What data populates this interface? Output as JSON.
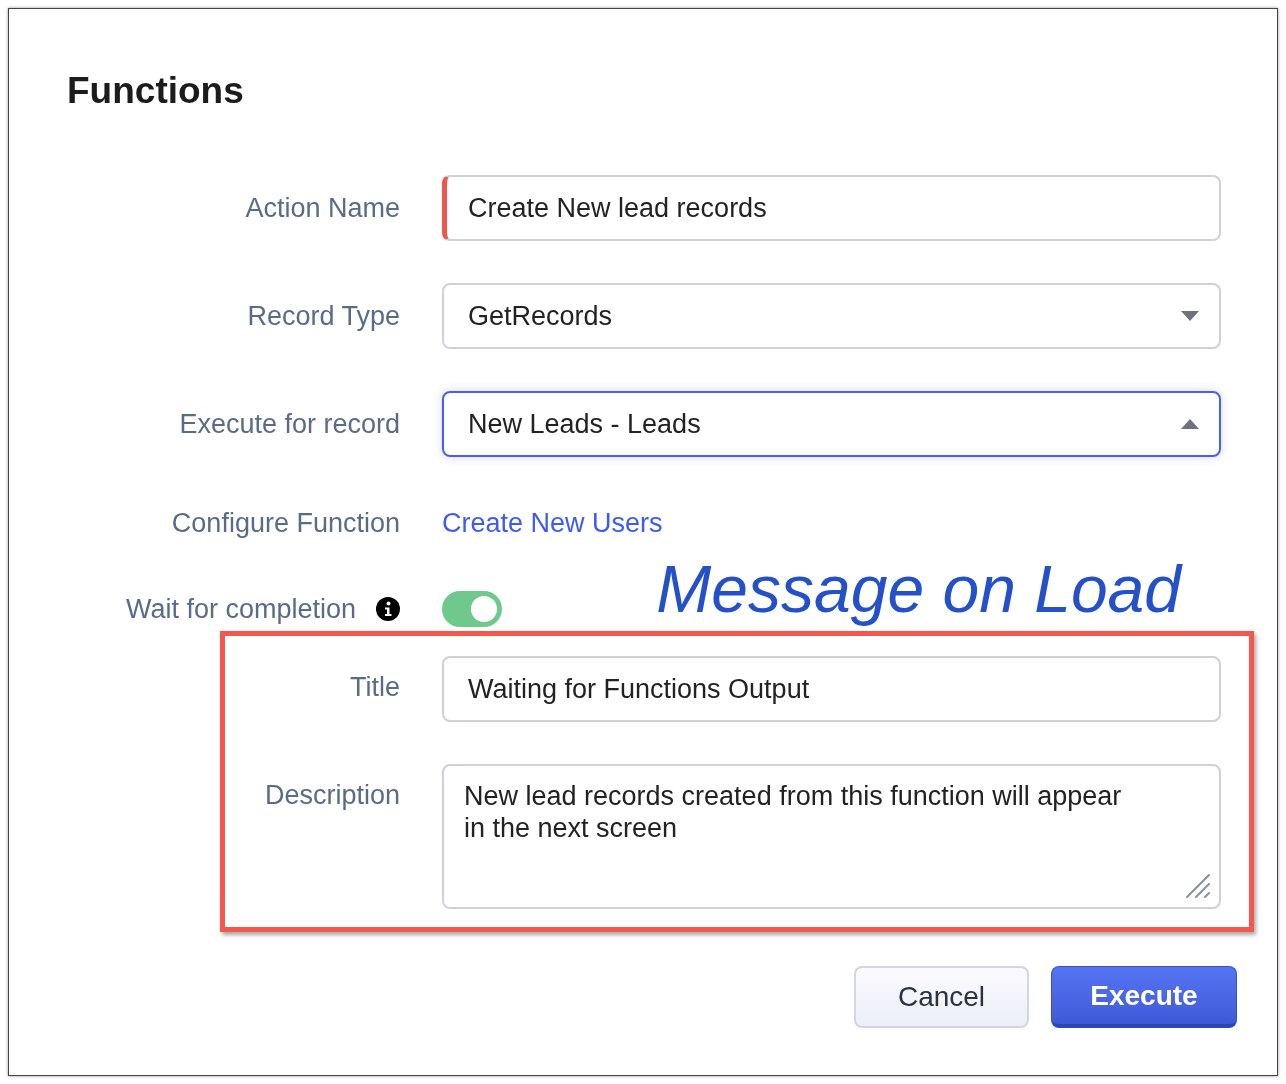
{
  "dialog": {
    "title": "Functions"
  },
  "fields": [
    {
      "kind": "text",
      "label": "Action Name",
      "value": "Create New lead records",
      "required": true
    },
    {
      "kind": "select",
      "label": "Record Type",
      "value": "GetRecords",
      "expanded": false
    },
    {
      "kind": "select",
      "label": "Execute for record",
      "value": "New Leads - Leads",
      "expanded": true
    },
    {
      "kind": "link",
      "label": "Configure Function",
      "value": "Create New Users"
    },
    {
      "kind": "toggle",
      "label": "Wait for completion",
      "on": true
    }
  ],
  "annotation": {
    "text": "Message on Load"
  },
  "message_fields": [
    {
      "kind": "text",
      "label": "Title",
      "value": "Waiting for Functions Output"
    },
    {
      "kind": "textarea",
      "label": "Description",
      "value": "New lead records created from this function will appear in the next screen"
    }
  ],
  "buttons": [
    {
      "label": "Cancel",
      "kind": "secondary"
    },
    {
      "label": "Execute",
      "kind": "primary"
    }
  ]
}
